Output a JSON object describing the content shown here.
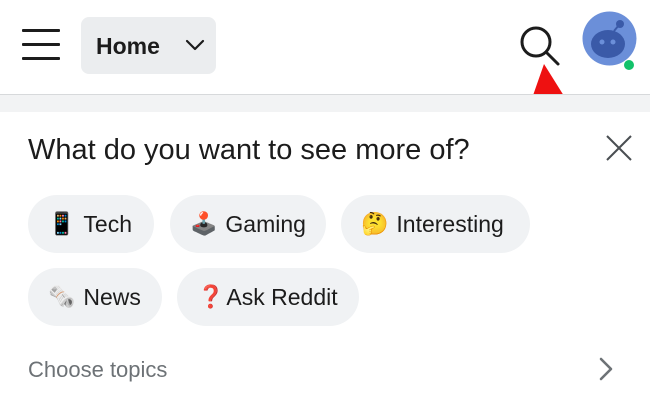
{
  "header": {
    "feed_selector_label": "Home",
    "icons": {
      "menu": "hamburger-menu-icon",
      "chevron": "chevron-down-icon",
      "search": "search-icon",
      "avatar": "snoo-avatar",
      "arrow": "red-arrow-annotation"
    },
    "colors": {
      "online_status": "#13c26a",
      "annotation_arrow": "#ee1111",
      "avatar_bg": "#6b8fd9"
    }
  },
  "prompt": {
    "title": "What do you want to see more of?",
    "topics": [
      {
        "emoji": "📱",
        "label": "Tech"
      },
      {
        "emoji": "🕹️",
        "label": "Gaming"
      },
      {
        "emoji": "🤔",
        "label": "Interesting"
      },
      {
        "emoji": "🗞️",
        "label": "News"
      },
      {
        "emoji": "❓",
        "label": "Ask Reddit"
      }
    ],
    "choose_topics_label": "Choose topics"
  }
}
